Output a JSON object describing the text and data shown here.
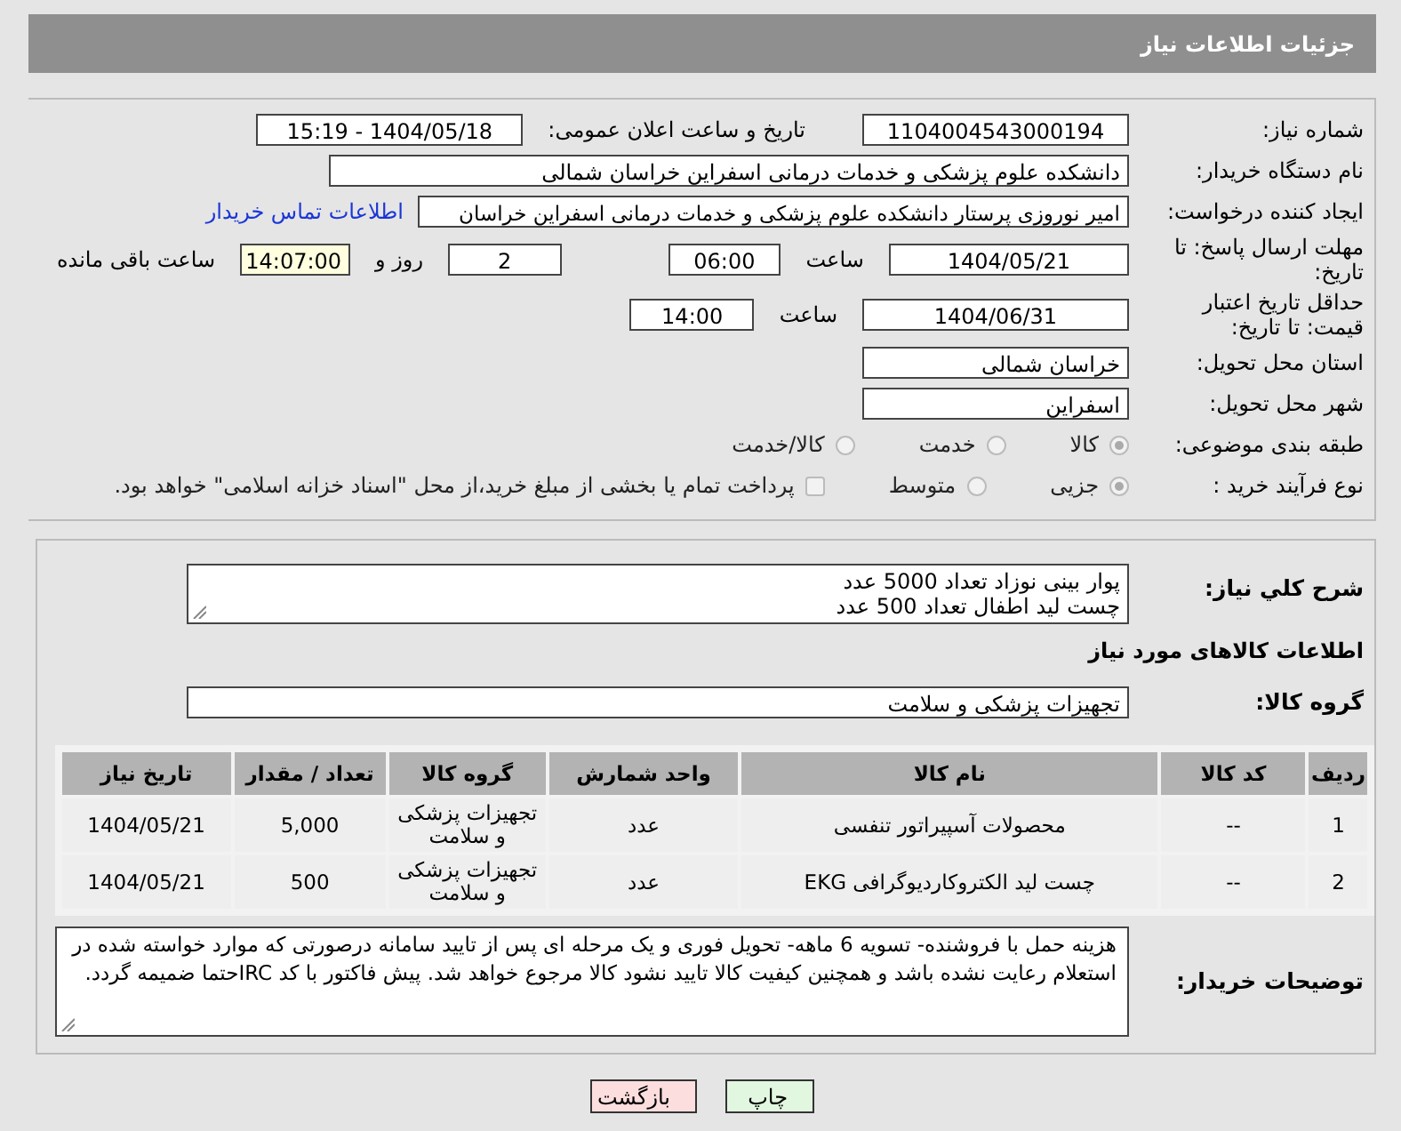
{
  "header": {
    "title": "جزئیات اطلاعات نیاز"
  },
  "need_number": {
    "label": "شماره نیاز:",
    "value": "1104004543000194"
  },
  "announce": {
    "label": "تاریخ و ساعت اعلان عمومی:",
    "value": "1404/05/18 - 15:19"
  },
  "buyer_org": {
    "label": "نام دستگاه خریدار:",
    "value": "دانشکده علوم پزشکی و خدمات درمانی اسفراین خراسان شمالی"
  },
  "requester": {
    "label": "ایجاد کننده درخواست:",
    "value": "امیر  نوروزی  پرستار  دانشکده علوم پزشکی و خدمات درمانی اسفراین خراسان",
    "link": "اطلاعات تماس خریدار"
  },
  "reply_deadline": {
    "label": "مهلت ارسال پاسخ: تا تاریخ:",
    "date": "1404/05/21",
    "time_label": "ساعت",
    "time": "06:00",
    "days": "2",
    "days_label": "روز و",
    "remaining": "14:07:00",
    "remaining_label": "ساعت باقی مانده"
  },
  "price_validity": {
    "label": "حداقل تاریخ اعتبار قیمت: تا تاریخ:",
    "date": "1404/06/31",
    "time_label": "ساعت",
    "time": "14:00"
  },
  "province": {
    "label": "استان محل تحویل:",
    "value": "خراسان شمالی"
  },
  "city": {
    "label": "شهر محل تحویل:",
    "value": "اسفراین"
  },
  "category": {
    "label": "طبقه بندی موضوعی:",
    "options": [
      {
        "label": "کالا",
        "selected": true
      },
      {
        "label": "خدمت",
        "selected": false
      },
      {
        "label": "کالا/خدمت",
        "selected": false
      }
    ]
  },
  "process": {
    "label": "نوع فرآیند خرید :",
    "options": [
      {
        "label": "جزیی",
        "selected": true
      },
      {
        "label": "متوسط",
        "selected": false
      }
    ],
    "treasury": {
      "label": "پرداخت تمام یا بخشی از مبلغ خرید،از محل \"اسناد خزانه اسلامی\" خواهد بود.",
      "checked": false
    }
  },
  "description": {
    "label": "شرح كلي نياز:",
    "lines": [
      "پوار بینی نوزاد تعداد 5000 عدد",
      "چست لید اطفال تعداد 500 عدد"
    ]
  },
  "goods_title": "اطلاعات کالاهای مورد نیاز",
  "goods_group": {
    "label": "گروه کالا:",
    "value": "تجهیزات پزشکی و سلامت"
  },
  "table": {
    "columns": [
      "ردیف",
      "کد کالا",
      "نام کالا",
      "واحد شمارش",
      "گروه کالا",
      "تعداد / مقدار",
      "تاریخ نیاز"
    ],
    "rows": [
      [
        "1",
        "--",
        "محصولات آسپیراتور تنفسی",
        "عدد",
        "تجهیزات پزشکی و سلامت",
        "5,000",
        "1404/05/21"
      ],
      [
        "2",
        "--",
        "چست لید الکتروکاردیوگرافی EKG",
        "عدد",
        "تجهیزات پزشکی و سلامت",
        "500",
        "1404/05/21"
      ]
    ]
  },
  "notes": {
    "label": "توضیحات خریدار:",
    "value": "هزینه حمل با فروشنده- تسویه 6 ماهه- تحویل فوری و یک مرحله ای پس از تایید سامانه درصورتی که موارد خواسته شده در استعلام رعایت نشده باشد و همچنین کیفیت کالا تایید نشود کالا مرجوع خواهد شد. پیش فاکتور با کد IRCحتما ضمیمه گردد."
  },
  "buttons": [
    {
      "label": "چاپ",
      "kind": "print"
    },
    {
      "label": "بازگشت",
      "kind": "back"
    }
  ]
}
